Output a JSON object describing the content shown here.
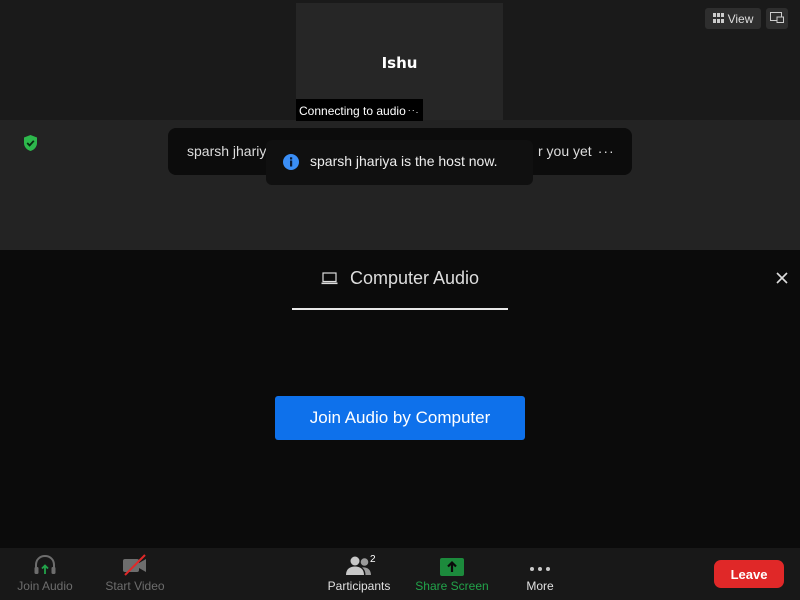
{
  "video_tile": {
    "name": "Ishu",
    "status": "Connecting to audio",
    "status_dots": "··."
  },
  "top_controls": {
    "view_label": "View"
  },
  "notifications": {
    "back_text_left": "sparsh jhariya",
    "back_text_right": "r you yet",
    "back_dots": "···",
    "front_text": "sparsh jhariya is the host now."
  },
  "audio_dialog": {
    "tab_label": "Computer Audio",
    "join_button": "Join Audio by Computer"
  },
  "toolbar": {
    "join_audio": "Join Audio",
    "start_video": "Start Video",
    "participants": "Participants",
    "participants_count": "2",
    "share_screen": "Share Screen",
    "more": "More",
    "leave": "Leave"
  },
  "colors": {
    "accent_blue": "#0e71eb",
    "leave_red": "#e02828",
    "share_green": "#22a34a",
    "shield_green": "#2db84c"
  },
  "icons": [
    "view-grid-icon",
    "pip-icon",
    "shield-check-icon",
    "info-icon",
    "laptop-icon",
    "close-icon",
    "headphone-icon",
    "video-off-icon",
    "participants-icon",
    "share-screen-icon",
    "more-icon"
  ]
}
